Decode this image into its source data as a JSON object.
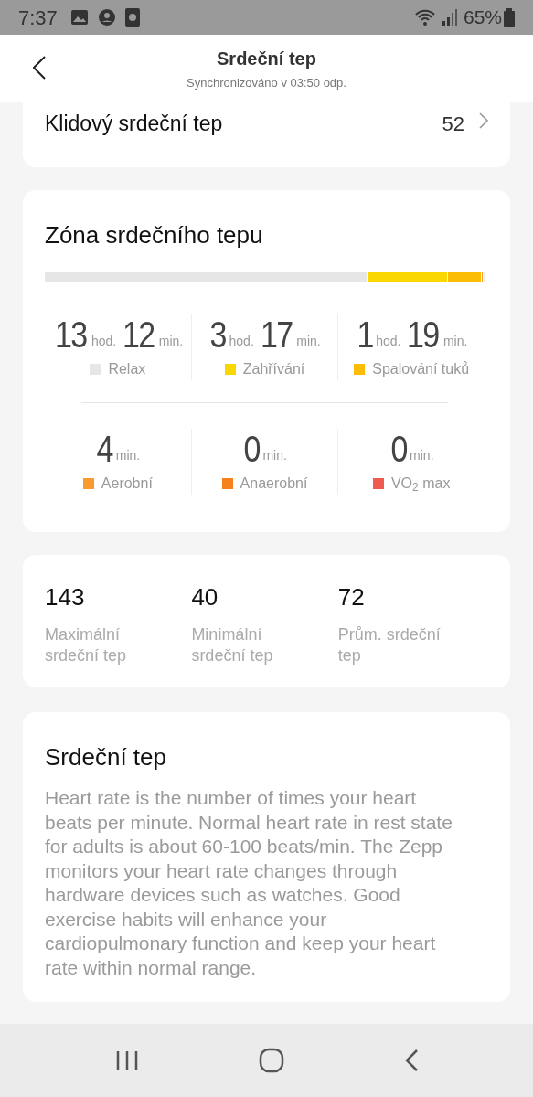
{
  "status_bar": {
    "time": "7:37",
    "battery": "65%"
  },
  "header": {
    "title": "Srdeční tep",
    "subtitle": "Synchronizováno v 03:50 odp."
  },
  "resting": {
    "label": "Klidový srdeční tep",
    "value": "52"
  },
  "zones": {
    "title": "Zóna srdečního tepu",
    "items": [
      {
        "parts": [
          {
            "number": "13",
            "unit": "hod."
          },
          {
            "number": "12",
            "unit": "min."
          }
        ],
        "label": "Relax",
        "color": "#e6e6e6"
      },
      {
        "parts": [
          {
            "number": "3",
            "unit": "hod."
          },
          {
            "number": "17",
            "unit": "min."
          }
        ],
        "label": "Zahřívání",
        "color": "#fad700"
      },
      {
        "parts": [
          {
            "number": "1",
            "unit": "hod."
          },
          {
            "number": "19",
            "unit": "min."
          }
        ],
        "label": "Spalování tuků",
        "color": "#fbbc05"
      },
      {
        "parts": [
          {
            "number": "4",
            "unit": "min."
          }
        ],
        "label": "Aerobní",
        "color": "#f99a2c"
      },
      {
        "parts": [
          {
            "number": "0",
            "unit": "min."
          }
        ],
        "label": "Anaerobní",
        "color": "#f7821b"
      },
      {
        "parts": [
          {
            "number": "0",
            "unit": "min."
          }
        ],
        "label": "VO$_{2}$ max",
        "color": "#f05a50"
      }
    ]
  },
  "stats": [
    {
      "value": "143",
      "label": "Maximální srdeční tep"
    },
    {
      "value": "40",
      "label": "Minimální srdeční tep"
    },
    {
      "value": "72",
      "label": "Prům. srdeční tep"
    }
  ],
  "info": {
    "title": "Srdeční tep",
    "text": "Heart rate is the number of times your heart beats per minute. Normal heart rate in rest state for adults is about 60-100 beats/min. The Zepp monitors your heart rate changes through hardware devices such as watches. Good exercise habits will enhance your cardiopulmonary function and keep your heart rate within normal range."
  }
}
